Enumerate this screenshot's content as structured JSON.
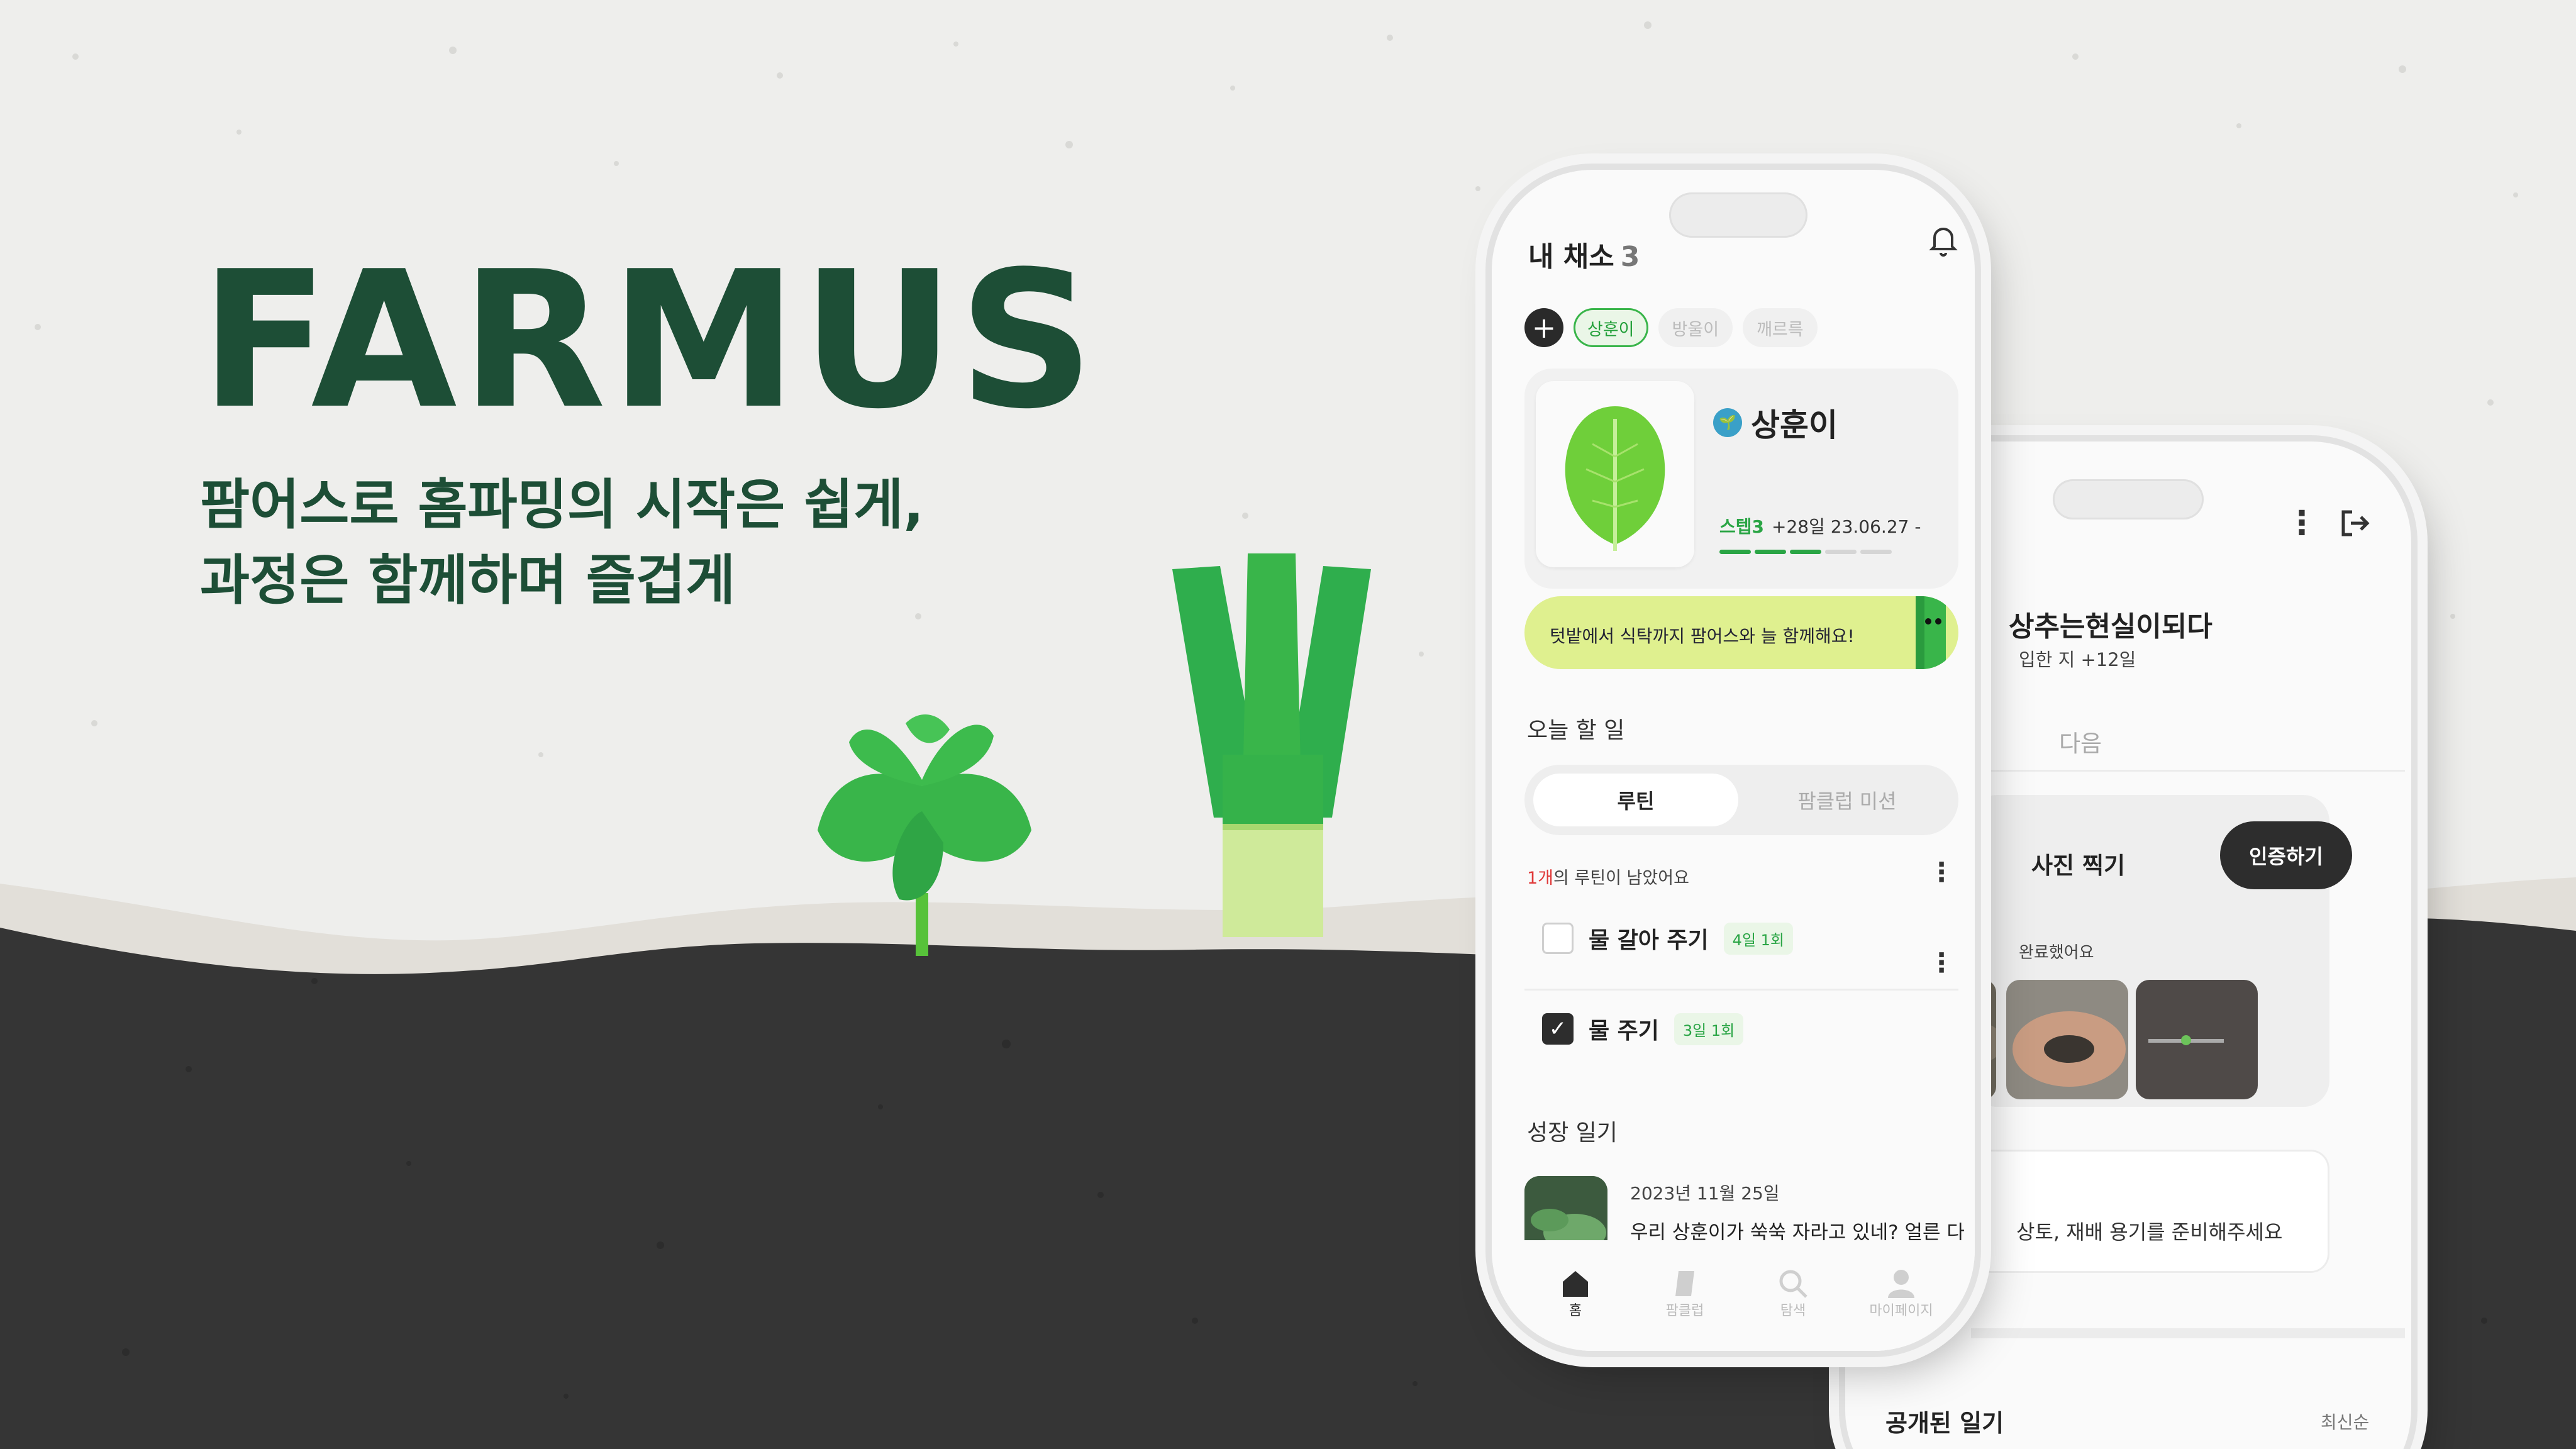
{
  "brand": {
    "name": "FARMUS",
    "color": "#1d4e36"
  },
  "tagline": {
    "line1": "팜어스로 홈파밍의 시작은 쉽게,",
    "line2": "과정은 함께하며 즐겁게"
  },
  "front_phone": {
    "title": "내 채소",
    "count": "3",
    "bell_icon": "bell-icon",
    "chips": [
      "상훈이",
      "방울이",
      "깨르륵"
    ],
    "active_chip": "상훈이",
    "add_icon": "+",
    "plant": {
      "name": "상훈이",
      "step": "스텝3",
      "detail": "+28일 23.06.27 -",
      "progress_steps_done": 3,
      "progress_steps_total": 5
    },
    "banner": "텃밭에서 식탁까지 팜어스와 늘 함께해요!",
    "today_title": "오늘 할 일",
    "segment": {
      "active": "루틴",
      "inactive": "팜클럽 미션"
    },
    "remaining": {
      "count": "1개",
      "suffix": "의 루틴이 남았어요"
    },
    "tasks": [
      {
        "label": "물 갈아 주기",
        "freq": "4일 1회",
        "checked": false
      },
      {
        "label": "물 주기",
        "freq": "3일 1회",
        "checked": true
      }
    ],
    "diary_title": "성장 일기",
    "diary": {
      "date": "2023년 11월 25일",
      "text": "우리 상훈이가 쑥쑥 자라고 있네? 얼른 다"
    },
    "tabs": [
      {
        "label": "홈",
        "icon": "home-icon",
        "active": true
      },
      {
        "label": "팜클럽",
        "icon": "farmclub-icon",
        "active": false
      },
      {
        "label": "탐색",
        "icon": "search-icon",
        "active": false
      },
      {
        "label": "마이페이지",
        "icon": "user-icon",
        "active": false
      }
    ]
  },
  "back_phone": {
    "title": "상추는현실이되다",
    "subtitle": "입한 지 +12일",
    "tab": "다음",
    "photo_title": "사진 찍기",
    "verify_button": "인증하기",
    "done_text": "완료했어요",
    "notice": "상토, 재배 용기를 준비해주세요",
    "public_diary": "공개된 일기",
    "sort": "최신순",
    "kebab_icon": "kebab-icon",
    "logout_icon": "logout-icon"
  },
  "colors": {
    "accent_green": "#2aa545",
    "banner": "#dff08f",
    "ground_dark": "#353535",
    "background": "#eeeeec"
  }
}
